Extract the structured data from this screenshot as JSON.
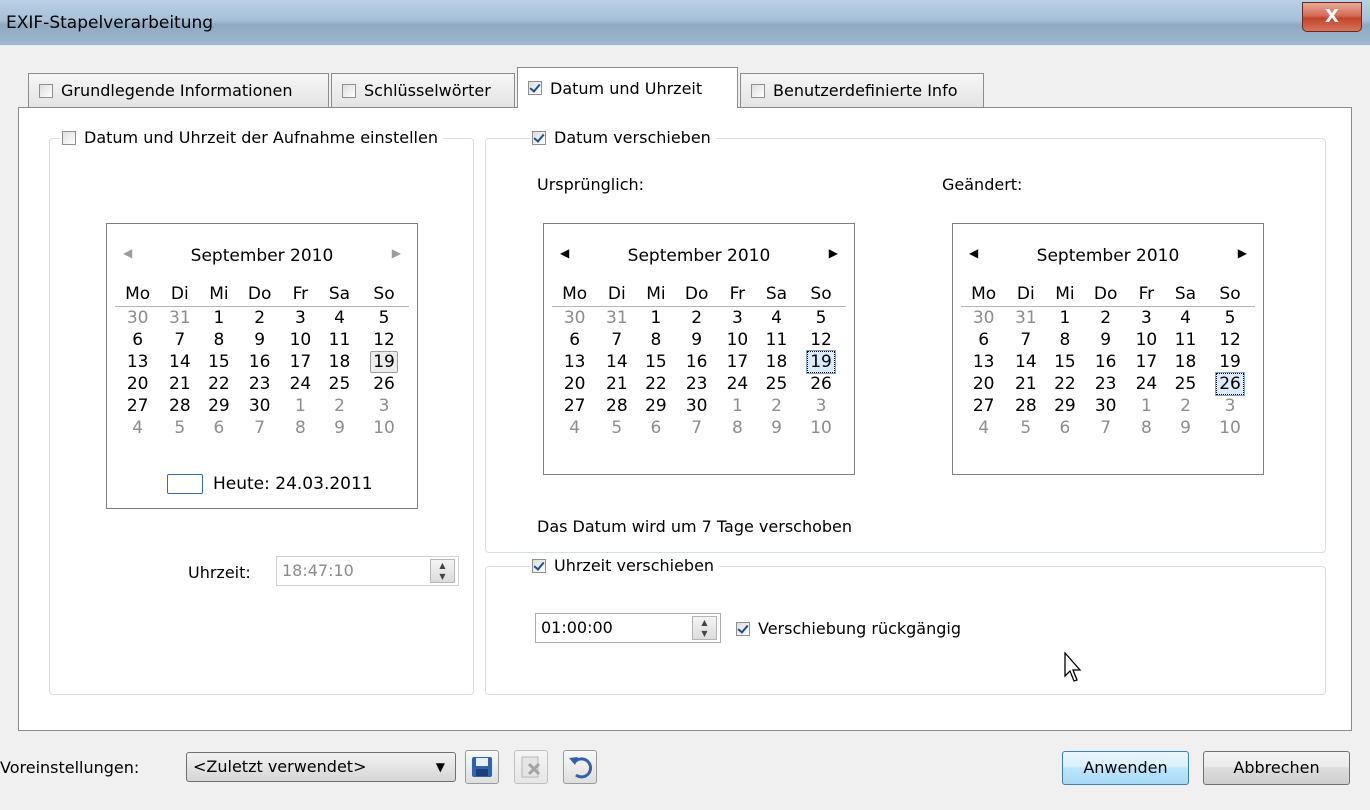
{
  "window": {
    "title": "EXIF-Stapelverarbeitung",
    "close_label": "X"
  },
  "tabs": [
    {
      "label": "Grundlegende Informationen",
      "checked": false
    },
    {
      "label": "Schlüsselwörter",
      "checked": false
    },
    {
      "label": "Datum und Uhrzeit",
      "checked": true,
      "active": true
    },
    {
      "label": "Benutzerdefinierte Info",
      "checked": false
    }
  ],
  "capture": {
    "legend": "Datum und Uhrzeit der Aufnahme einstellen",
    "calendar": {
      "month": "September 2010",
      "today": "Heute: 24.03.2011"
    },
    "time_label": "Uhrzeit:",
    "time_value": "18:47:10"
  },
  "shift_date": {
    "legend": "Datum verschieben",
    "original_label": "Ursprünglich:",
    "changed_label": "Geändert:",
    "original_month": "September 2010",
    "changed_month": "September 2010",
    "info": "Das Datum wird um 7 Tage verschoben"
  },
  "shift_time": {
    "legend": "Uhrzeit verschieben",
    "value": "01:00:00",
    "undo_label": "Verschiebung rückgängig"
  },
  "calendar_grid": {
    "weekdays": [
      "Mo",
      "Di",
      "Mi",
      "Do",
      "Fr",
      "Sa",
      "So"
    ],
    "weeks": [
      [
        "30",
        "31",
        "1",
        "2",
        "3",
        "4",
        "5"
      ],
      [
        "6",
        "7",
        "8",
        "9",
        "10",
        "11",
        "12"
      ],
      [
        "13",
        "14",
        "15",
        "16",
        "17",
        "18",
        "19"
      ],
      [
        "20",
        "21",
        "22",
        "23",
        "24",
        "25",
        "26"
      ],
      [
        "27",
        "28",
        "29",
        "30",
        "1",
        "2",
        "3"
      ],
      [
        "4",
        "5",
        "6",
        "7",
        "8",
        "9",
        "10"
      ]
    ]
  },
  "footer": {
    "presets_label": "Voreinstellungen:",
    "presets_value": "<Zuletzt verwendet>",
    "apply_label": "Anwenden",
    "cancel_label": "Abbrechen"
  }
}
